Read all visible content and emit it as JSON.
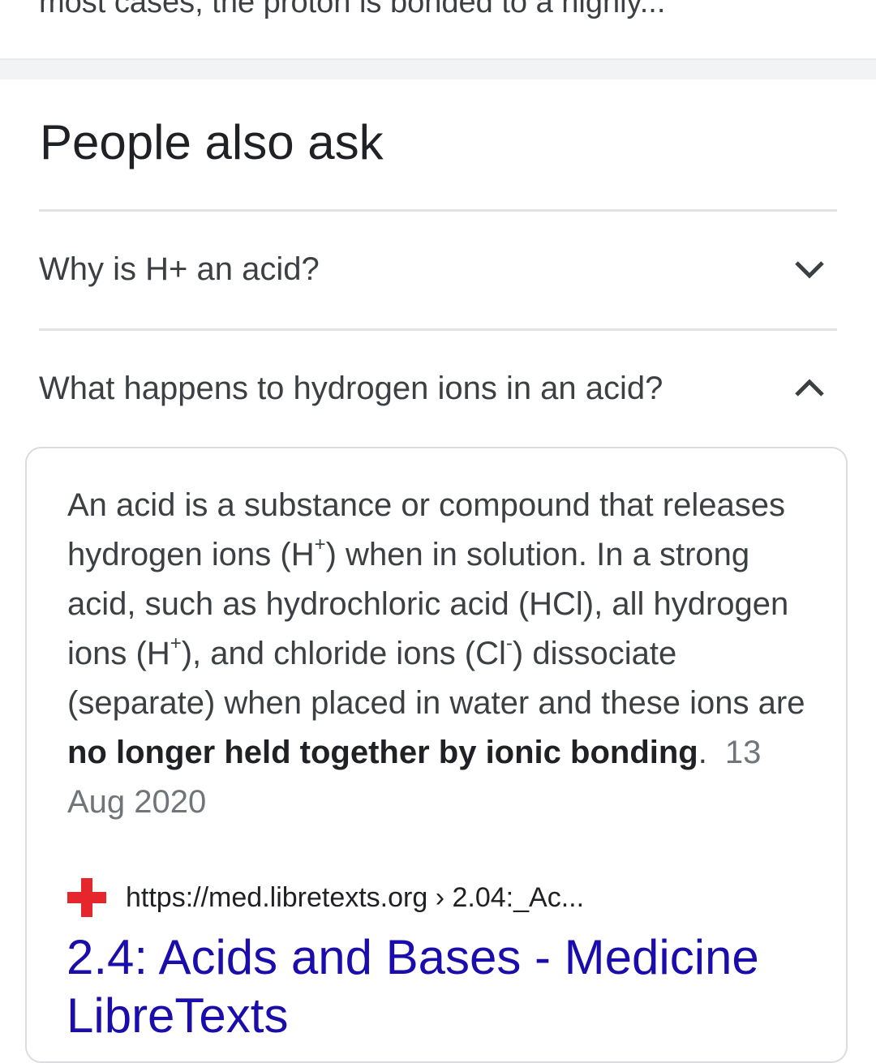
{
  "previous_result": {
    "snippet_tail": "most cases, the proton is bonded to a highly..."
  },
  "people_also_ask": {
    "heading": "People also ask",
    "questions": [
      {
        "text": "Why is H+ an acid?",
        "expanded": false,
        "icon": "chevron-down-icon"
      },
      {
        "text": "What happens to hydrogen ions in an acid?",
        "expanded": true,
        "icon": "chevron-up-icon"
      }
    ],
    "answer": {
      "t1": "An acid is a substance or compound that releases hydrogen ions (H",
      "sup1": "+",
      "t2": ") when in solution. In a strong acid, such as hydrochloric acid (HCl), all hydrogen ions (H",
      "sup2": "+",
      "t3": "), and chloride ions (Cl",
      "sup3": "-",
      "t4": ") dissociate (separate) when placed in water and these ions are ",
      "bold": "no longer held together by ionic bonding",
      "t5": ".",
      "date": "13 Aug 2020",
      "source": {
        "favicon": "red-cross-icon",
        "url": "https://med.libretexts.org › 2.04:_Ac...",
        "title": "2.4: Acids and Bases - Medicine LibreTexts"
      }
    }
  },
  "colors": {
    "link": "#1a0dab",
    "favicon": "#e5262c",
    "divider": "#e3e3e3"
  }
}
